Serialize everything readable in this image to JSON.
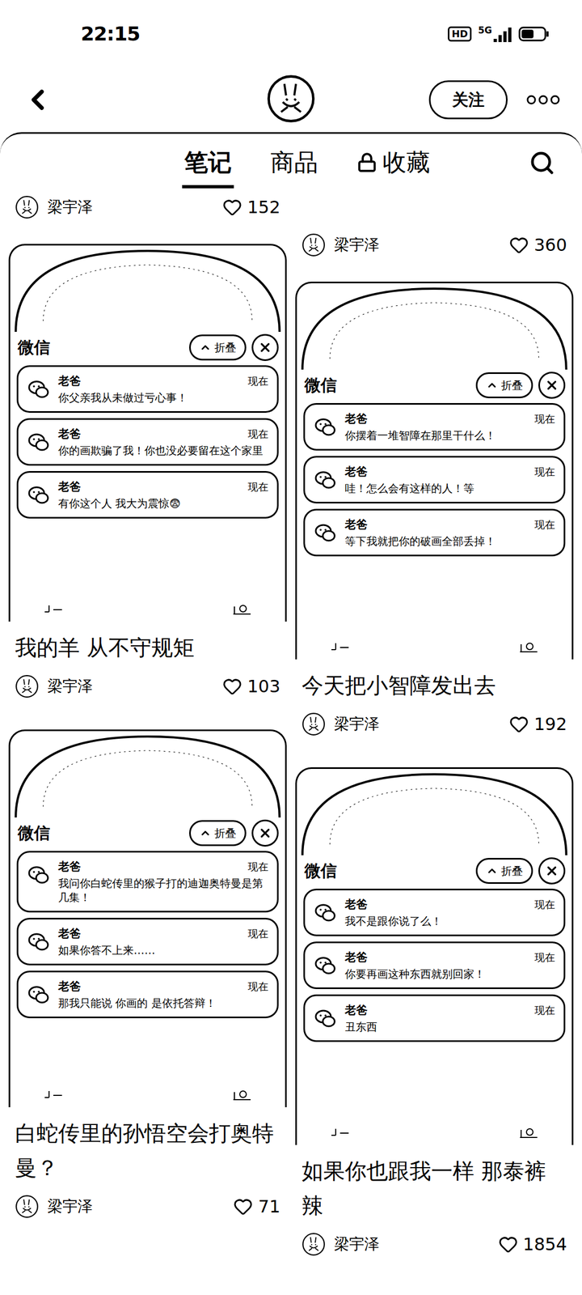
{
  "status_bar": {
    "time": "22:15",
    "hd": "HD",
    "network": "5G",
    "battery_level": 0.55
  },
  "header": {
    "follow_button": "关注"
  },
  "tabs": [
    {
      "label": "笔记",
      "selected": true,
      "locked": false
    },
    {
      "label": "商品",
      "selected": false,
      "locked": false
    },
    {
      "label": "收藏",
      "selected": false,
      "locked": true
    }
  ],
  "feed": {
    "left": {
      "top_row": {
        "author": "梁宇泽",
        "likes": "152"
      },
      "notes": [
        {
          "app": "微信",
          "collapse": "折叠",
          "notifications": [
            {
              "sender": "老爸",
              "time": "现在",
              "message": "你父亲我从未做过亏心事！"
            },
            {
              "sender": "老爸",
              "time": "现在",
              "message": "你的画欺骗了我！你也没必要留在这个家里"
            },
            {
              "sender": "老爸",
              "time": "现在",
              "message": "有你这个人 我大为震惊😨"
            }
          ],
          "title": "我的羊 从不守规矩",
          "author": "梁宇泽",
          "likes": "103"
        },
        {
          "app": "微信",
          "collapse": "折叠",
          "notifications": [
            {
              "sender": "老爸",
              "time": "现在",
              "message": "我问你白蛇传里的猴子打的迪迦奥特曼是第几集！"
            },
            {
              "sender": "老爸",
              "time": "现在",
              "message": "如果你答不上来……"
            },
            {
              "sender": "老爸",
              "time": "现在",
              "message": "那我只能说 你画的 是依托答辩！"
            }
          ],
          "title": "白蛇传里的孙悟空会打奥特曼？",
          "author": "梁宇泽",
          "likes": "71"
        }
      ]
    },
    "right": {
      "top_row": {
        "author": "梁宇泽",
        "likes": "360"
      },
      "notes": [
        {
          "app": "微信",
          "collapse": "折叠",
          "notifications": [
            {
              "sender": "老爸",
              "time": "现在",
              "message": "你摆着一堆智障在那里干什么！"
            },
            {
              "sender": "老爸",
              "time": "现在",
              "message": "哇！怎么会有这样的人！等"
            },
            {
              "sender": "老爸",
              "time": "现在",
              "message": "等下我就把你的破画全部丢掉！"
            }
          ],
          "title": "今天把小智障发出去",
          "author": "梁宇泽",
          "likes": "192"
        },
        {
          "app": "微信",
          "collapse": "折叠",
          "notifications": [
            {
              "sender": "老爸",
              "time": "现在",
              "message": "我不是跟你说了么！"
            },
            {
              "sender": "老爸",
              "time": "现在",
              "message": "你要再画这种东西就别回家！"
            },
            {
              "sender": "老爸",
              "time": "现在",
              "message": "丑东西"
            }
          ],
          "title": "如果你也跟我一样 那泰裤辣",
          "author": "梁宇泽",
          "likes": "1854"
        }
      ]
    }
  }
}
